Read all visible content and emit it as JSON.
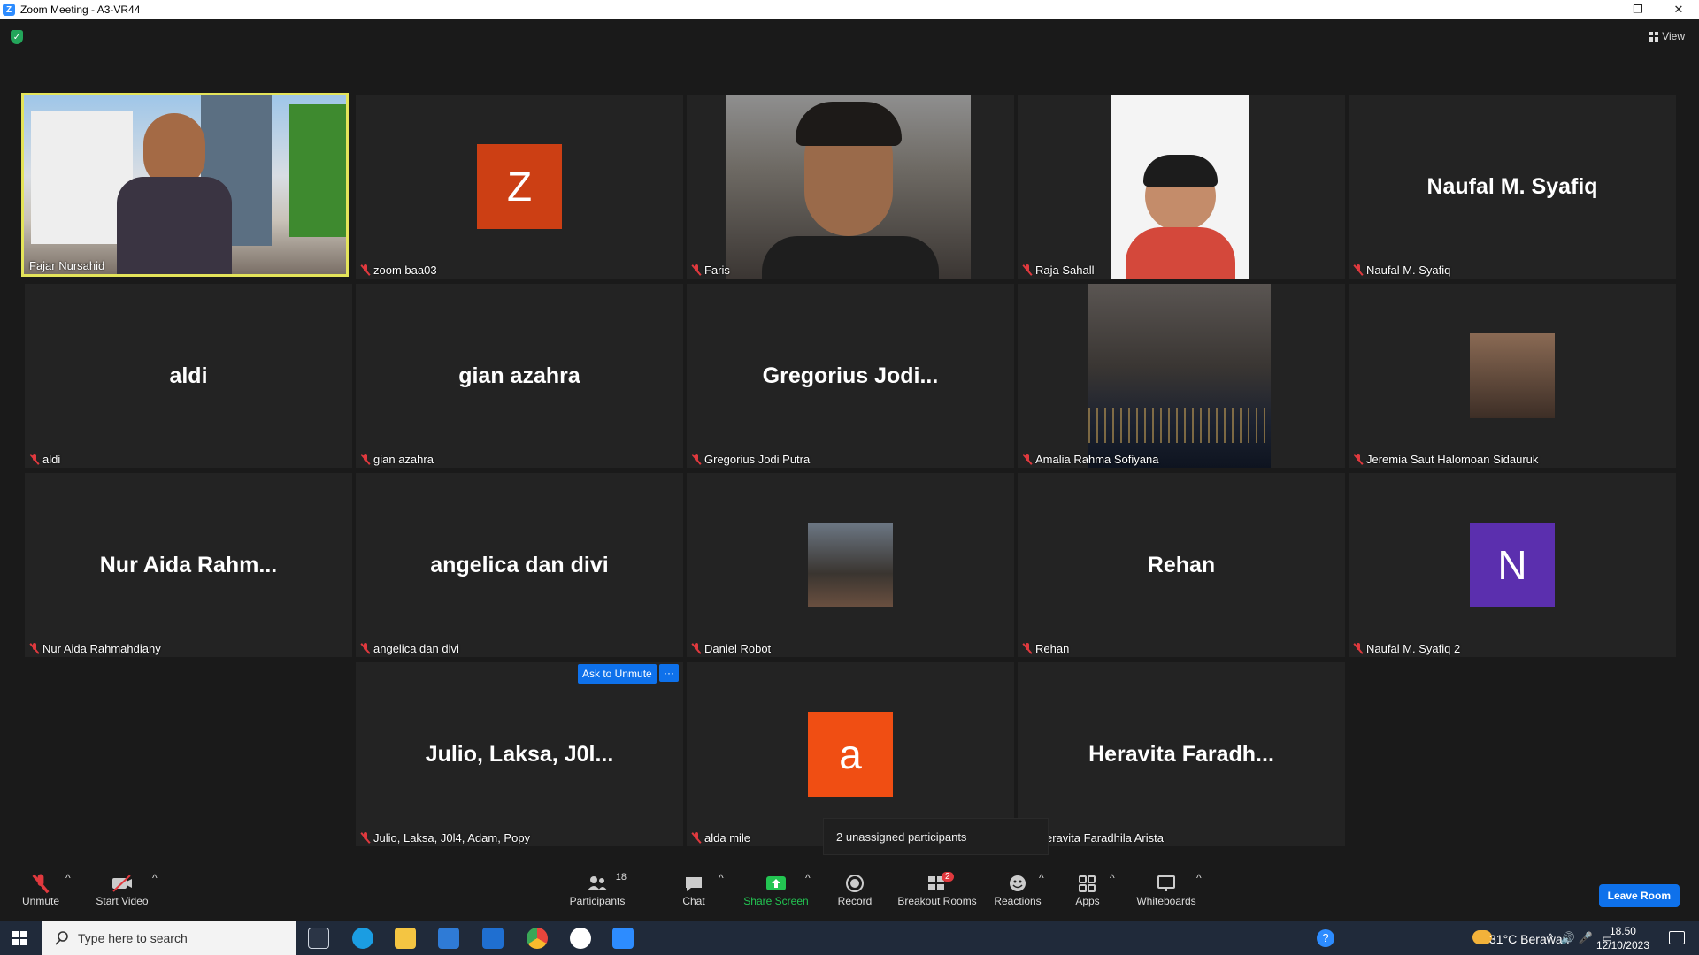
{
  "window": {
    "title": "Zoom Meeting - A3-VR44",
    "logo_letter": "Z"
  },
  "view_label": "View",
  "tiles": [
    {
      "name": "Fajar Nursahid",
      "display": "",
      "kind": "video",
      "active": true
    },
    {
      "name": "zoom baa03",
      "display": "",
      "kind": "avatar",
      "avatar_letter": "Z",
      "avatar_color": "#cc3f14"
    },
    {
      "name": "Faris",
      "display": "",
      "kind": "video"
    },
    {
      "name": "Raja Sahall",
      "display": "",
      "kind": "video"
    },
    {
      "name": "Naufal M. Syafiq",
      "display": "Naufal M. Syafiq",
      "kind": "name"
    },
    {
      "name": "aldi",
      "display": "aldi",
      "kind": "name"
    },
    {
      "name": "gian azahra",
      "display": "gian azahra",
      "kind": "name"
    },
    {
      "name": "Gregorius Jodi Putra",
      "display": "Gregorius  Jodi...",
      "kind": "name"
    },
    {
      "name": "Amalia Rahma Sofiyana",
      "display": "",
      "kind": "video"
    },
    {
      "name": "Jeremia Saut Halomoan Sidauruk",
      "display": "",
      "kind": "photo"
    },
    {
      "name": "Nur Aida Rahmahdiany",
      "display": "Nur Aida Rahm...",
      "kind": "name"
    },
    {
      "name": "angelica dan divi",
      "display": "angelica dan divi",
      "kind": "name"
    },
    {
      "name": "Daniel Robot",
      "display": "",
      "kind": "photo"
    },
    {
      "name": "Rehan",
      "display": "Rehan",
      "kind": "name"
    },
    {
      "name": "Naufal M. Syafiq 2",
      "display": "",
      "kind": "avatar",
      "avatar_letter": "N",
      "avatar_color": "#5b2fae"
    },
    {
      "name": "Julio, Laksa, J0l4, Adam, Popy",
      "display": "Julio,  Laksa,  J0l...",
      "kind": "name"
    },
    {
      "name": "alda mile",
      "display": "",
      "kind": "avatar",
      "avatar_letter": "a",
      "avatar_color": "#f04e13"
    },
    {
      "name": "eravita Faradhila Arista",
      "display": "Heravita  Faradh...",
      "kind": "name"
    }
  ],
  "ask_to_unmute": "Ask to Unmute",
  "more_glyph": "···",
  "tooltip": "2 unassigned participants",
  "toolbar": {
    "unmute": "Unmute",
    "start_video": "Start Video",
    "participants": "Participants",
    "participants_count": "18",
    "chat": "Chat",
    "share_screen": "Share Screen",
    "record": "Record",
    "breakout_rooms": "Breakout Rooms",
    "breakout_badge": "2",
    "reactions": "Reactions",
    "apps": "Apps",
    "whiteboards": "Whiteboards",
    "leave": "Leave Room"
  },
  "taskbar": {
    "search_placeholder": "Type here to search",
    "weather": "31°C  Berawan",
    "time": "18.50",
    "date": "12/10/2023"
  },
  "colors": {
    "accent": "#0e71eb",
    "share_green": "#23c552",
    "active_border": "#e4e45a",
    "muted_red": "#e0393e"
  }
}
